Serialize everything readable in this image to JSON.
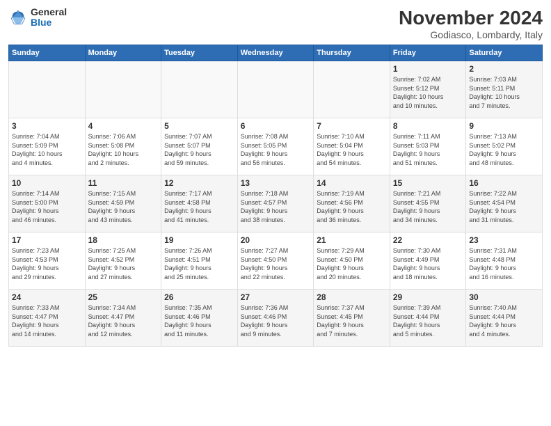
{
  "logo": {
    "general": "General",
    "blue": "Blue"
  },
  "title": "November 2024",
  "subtitle": "Godiasco, Lombardy, Italy",
  "weekdays": [
    "Sunday",
    "Monday",
    "Tuesday",
    "Wednesday",
    "Thursday",
    "Friday",
    "Saturday"
  ],
  "weeks": [
    [
      {
        "day": "",
        "info": ""
      },
      {
        "day": "",
        "info": ""
      },
      {
        "day": "",
        "info": ""
      },
      {
        "day": "",
        "info": ""
      },
      {
        "day": "",
        "info": ""
      },
      {
        "day": "1",
        "info": "Sunrise: 7:02 AM\nSunset: 5:12 PM\nDaylight: 10 hours\nand 10 minutes."
      },
      {
        "day": "2",
        "info": "Sunrise: 7:03 AM\nSunset: 5:11 PM\nDaylight: 10 hours\nand 7 minutes."
      }
    ],
    [
      {
        "day": "3",
        "info": "Sunrise: 7:04 AM\nSunset: 5:09 PM\nDaylight: 10 hours\nand 4 minutes."
      },
      {
        "day": "4",
        "info": "Sunrise: 7:06 AM\nSunset: 5:08 PM\nDaylight: 10 hours\nand 2 minutes."
      },
      {
        "day": "5",
        "info": "Sunrise: 7:07 AM\nSunset: 5:07 PM\nDaylight: 9 hours\nand 59 minutes."
      },
      {
        "day": "6",
        "info": "Sunrise: 7:08 AM\nSunset: 5:05 PM\nDaylight: 9 hours\nand 56 minutes."
      },
      {
        "day": "7",
        "info": "Sunrise: 7:10 AM\nSunset: 5:04 PM\nDaylight: 9 hours\nand 54 minutes."
      },
      {
        "day": "8",
        "info": "Sunrise: 7:11 AM\nSunset: 5:03 PM\nDaylight: 9 hours\nand 51 minutes."
      },
      {
        "day": "9",
        "info": "Sunrise: 7:13 AM\nSunset: 5:02 PM\nDaylight: 9 hours\nand 48 minutes."
      }
    ],
    [
      {
        "day": "10",
        "info": "Sunrise: 7:14 AM\nSunset: 5:00 PM\nDaylight: 9 hours\nand 46 minutes."
      },
      {
        "day": "11",
        "info": "Sunrise: 7:15 AM\nSunset: 4:59 PM\nDaylight: 9 hours\nand 43 minutes."
      },
      {
        "day": "12",
        "info": "Sunrise: 7:17 AM\nSunset: 4:58 PM\nDaylight: 9 hours\nand 41 minutes."
      },
      {
        "day": "13",
        "info": "Sunrise: 7:18 AM\nSunset: 4:57 PM\nDaylight: 9 hours\nand 38 minutes."
      },
      {
        "day": "14",
        "info": "Sunrise: 7:19 AM\nSunset: 4:56 PM\nDaylight: 9 hours\nand 36 minutes."
      },
      {
        "day": "15",
        "info": "Sunrise: 7:21 AM\nSunset: 4:55 PM\nDaylight: 9 hours\nand 34 minutes."
      },
      {
        "day": "16",
        "info": "Sunrise: 7:22 AM\nSunset: 4:54 PM\nDaylight: 9 hours\nand 31 minutes."
      }
    ],
    [
      {
        "day": "17",
        "info": "Sunrise: 7:23 AM\nSunset: 4:53 PM\nDaylight: 9 hours\nand 29 minutes."
      },
      {
        "day": "18",
        "info": "Sunrise: 7:25 AM\nSunset: 4:52 PM\nDaylight: 9 hours\nand 27 minutes."
      },
      {
        "day": "19",
        "info": "Sunrise: 7:26 AM\nSunset: 4:51 PM\nDaylight: 9 hours\nand 25 minutes."
      },
      {
        "day": "20",
        "info": "Sunrise: 7:27 AM\nSunset: 4:50 PM\nDaylight: 9 hours\nand 22 minutes."
      },
      {
        "day": "21",
        "info": "Sunrise: 7:29 AM\nSunset: 4:50 PM\nDaylight: 9 hours\nand 20 minutes."
      },
      {
        "day": "22",
        "info": "Sunrise: 7:30 AM\nSunset: 4:49 PM\nDaylight: 9 hours\nand 18 minutes."
      },
      {
        "day": "23",
        "info": "Sunrise: 7:31 AM\nSunset: 4:48 PM\nDaylight: 9 hours\nand 16 minutes."
      }
    ],
    [
      {
        "day": "24",
        "info": "Sunrise: 7:33 AM\nSunset: 4:47 PM\nDaylight: 9 hours\nand 14 minutes."
      },
      {
        "day": "25",
        "info": "Sunrise: 7:34 AM\nSunset: 4:47 PM\nDaylight: 9 hours\nand 12 minutes."
      },
      {
        "day": "26",
        "info": "Sunrise: 7:35 AM\nSunset: 4:46 PM\nDaylight: 9 hours\nand 11 minutes."
      },
      {
        "day": "27",
        "info": "Sunrise: 7:36 AM\nSunset: 4:46 PM\nDaylight: 9 hours\nand 9 minutes."
      },
      {
        "day": "28",
        "info": "Sunrise: 7:37 AM\nSunset: 4:45 PM\nDaylight: 9 hours\nand 7 minutes."
      },
      {
        "day": "29",
        "info": "Sunrise: 7:39 AM\nSunset: 4:44 PM\nDaylight: 9 hours\nand 5 minutes."
      },
      {
        "day": "30",
        "info": "Sunrise: 7:40 AM\nSunset: 4:44 PM\nDaylight: 9 hours\nand 4 minutes."
      }
    ]
  ]
}
